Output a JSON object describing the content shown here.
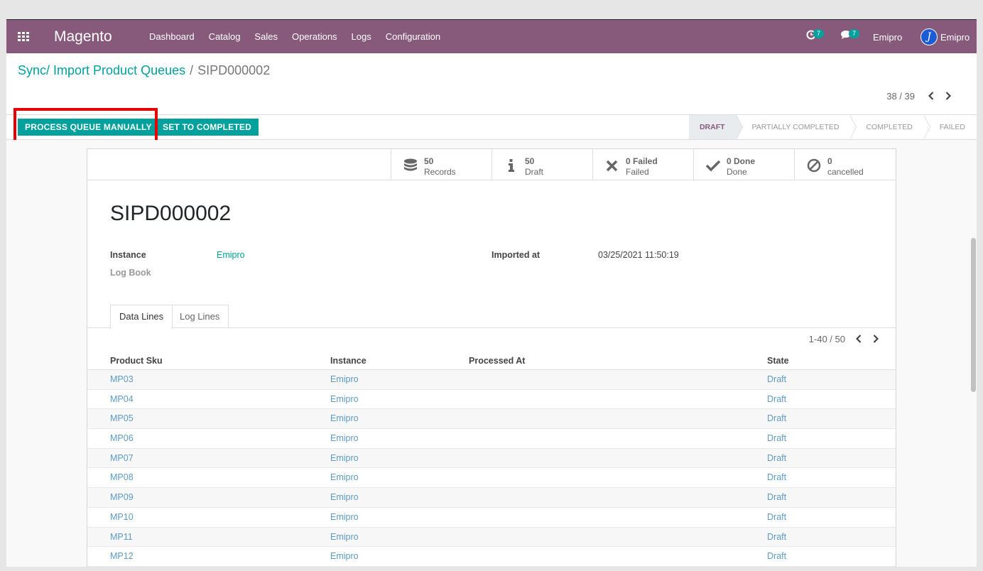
{
  "navbar": {
    "brand": "Magento",
    "menu": [
      "Dashboard",
      "Catalog",
      "Sales",
      "Operations",
      "Logs",
      "Configuration"
    ],
    "activity_count": "7",
    "messages_count": "7",
    "company": "Emipro",
    "user": "Emipro",
    "bg_color": "#875a7b"
  },
  "breadcrumb": {
    "parent": "Sync/ Import Product Queues",
    "separator": "/",
    "current": "SIPD000002"
  },
  "pager": {
    "value": "38 / 39"
  },
  "actions": {
    "process_queue": "PROCESS QUEUE MANUALLY",
    "set_completed": "SET TO COMPLETED"
  },
  "stages": [
    {
      "label": "DRAFT",
      "active": true
    },
    {
      "label": "PARTIALLY COMPLETED",
      "active": false
    },
    {
      "label": "COMPLETED",
      "active": false
    },
    {
      "label": "FAILED",
      "active": false
    }
  ],
  "stat_buttons": [
    {
      "icon": "database-icon",
      "value": "50",
      "label": "Records"
    },
    {
      "icon": "info-icon",
      "value": "50",
      "label": "Draft"
    },
    {
      "icon": "times-icon",
      "value": "0 Failed",
      "label": "Failed"
    },
    {
      "icon": "check-icon",
      "value": "0 Done",
      "label": "Done"
    },
    {
      "icon": "ban-icon",
      "value": "0",
      "label": "cancelled"
    }
  ],
  "record": {
    "name": "SIPD000002",
    "instance_label": "Instance",
    "instance_value": "Emipro",
    "log_book_label": "Log Book",
    "imported_at_label": "Imported at",
    "imported_at_value": "03/25/2021 11:50:19"
  },
  "tabs": [
    "Data Lines",
    "Log Lines"
  ],
  "list_pager": "1-40 / 50",
  "table": {
    "columns": [
      "Product Sku",
      "Instance",
      "Processed At",
      "State"
    ],
    "rows": [
      {
        "sku": "MP03",
        "instance": "Emipro",
        "processed_at": "",
        "state": "Draft"
      },
      {
        "sku": "MP04",
        "instance": "Emipro",
        "processed_at": "",
        "state": "Draft"
      },
      {
        "sku": "MP05",
        "instance": "Emipro",
        "processed_at": "",
        "state": "Draft"
      },
      {
        "sku": "MP06",
        "instance": "Emipro",
        "processed_at": "",
        "state": "Draft"
      },
      {
        "sku": "MP07",
        "instance": "Emipro",
        "processed_at": "",
        "state": "Draft"
      },
      {
        "sku": "MP08",
        "instance": "Emipro",
        "processed_at": "",
        "state": "Draft"
      },
      {
        "sku": "MP09",
        "instance": "Emipro",
        "processed_at": "",
        "state": "Draft"
      },
      {
        "sku": "MP10",
        "instance": "Emipro",
        "processed_at": "",
        "state": "Draft"
      },
      {
        "sku": "MP11",
        "instance": "Emipro",
        "processed_at": "",
        "state": "Draft"
      },
      {
        "sku": "MP12",
        "instance": "Emipro",
        "processed_at": "",
        "state": "Draft"
      }
    ]
  },
  "colors": {
    "primary": "#00a09d",
    "highlight": "#e60000",
    "link": "#5d9bc4"
  }
}
